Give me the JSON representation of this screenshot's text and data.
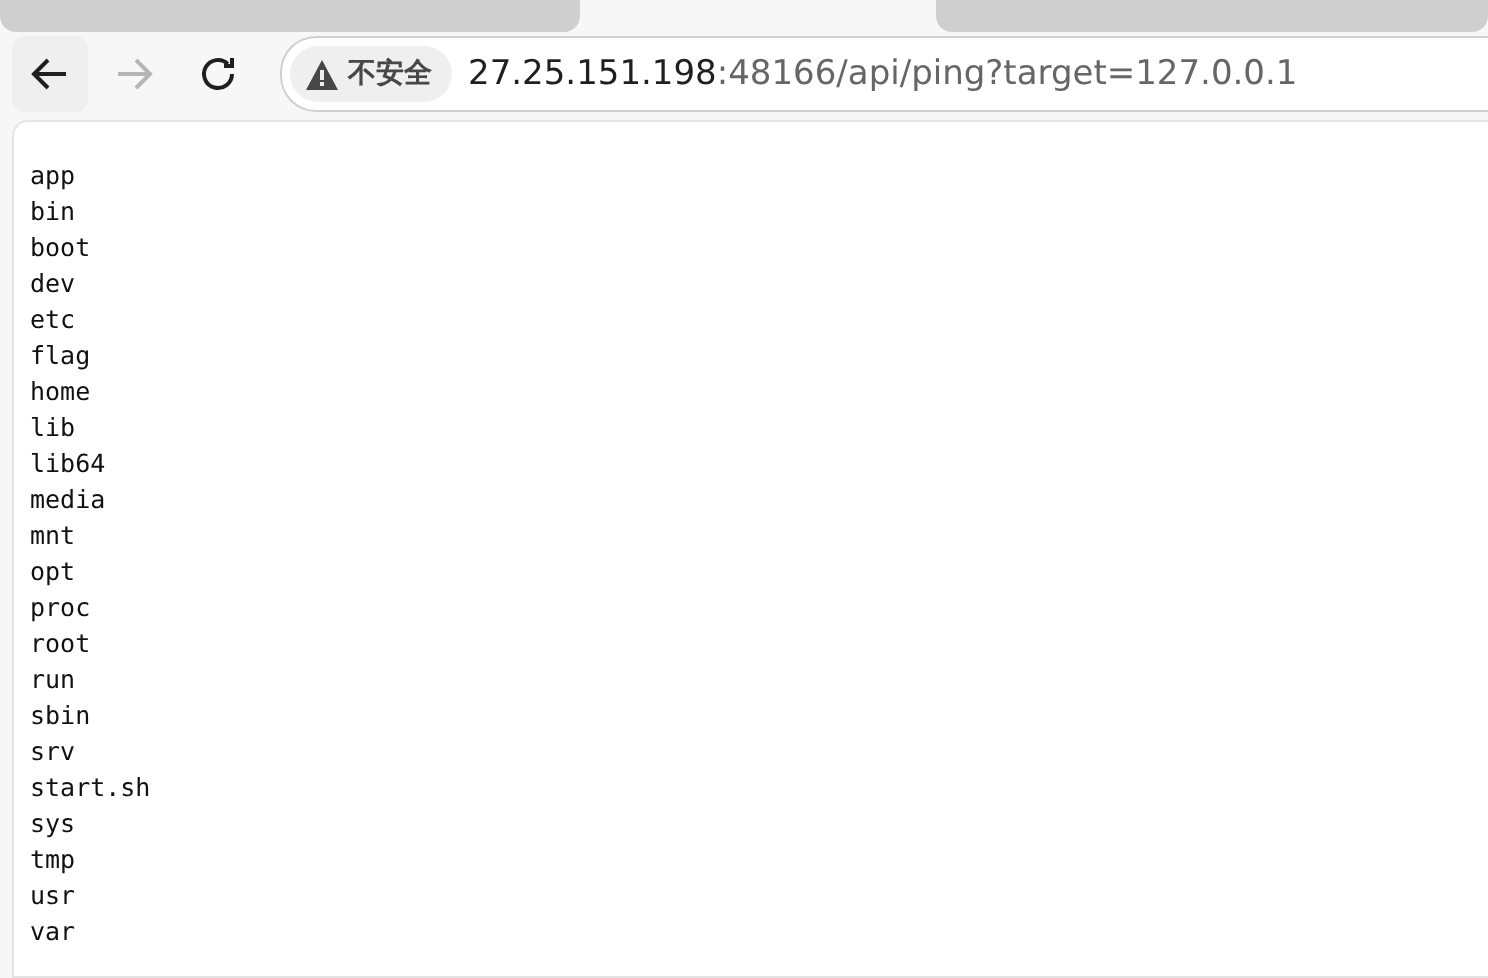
{
  "toolbar": {
    "back": {
      "disabled": false
    },
    "forward": {
      "disabled": true
    },
    "security_label": "不安全",
    "url": {
      "host": "27.25.151.198",
      "rest": ":48166/api/ping?target=127.0.0.1"
    }
  },
  "output_lines": [
    "app",
    "bin",
    "boot",
    "dev",
    "etc",
    "flag",
    "home",
    "lib",
    "lib64",
    "media",
    "mnt",
    "opt",
    "proc",
    "root",
    "run",
    "sbin",
    "srv",
    "start.sh",
    "sys",
    "tmp",
    "usr",
    "var"
  ]
}
